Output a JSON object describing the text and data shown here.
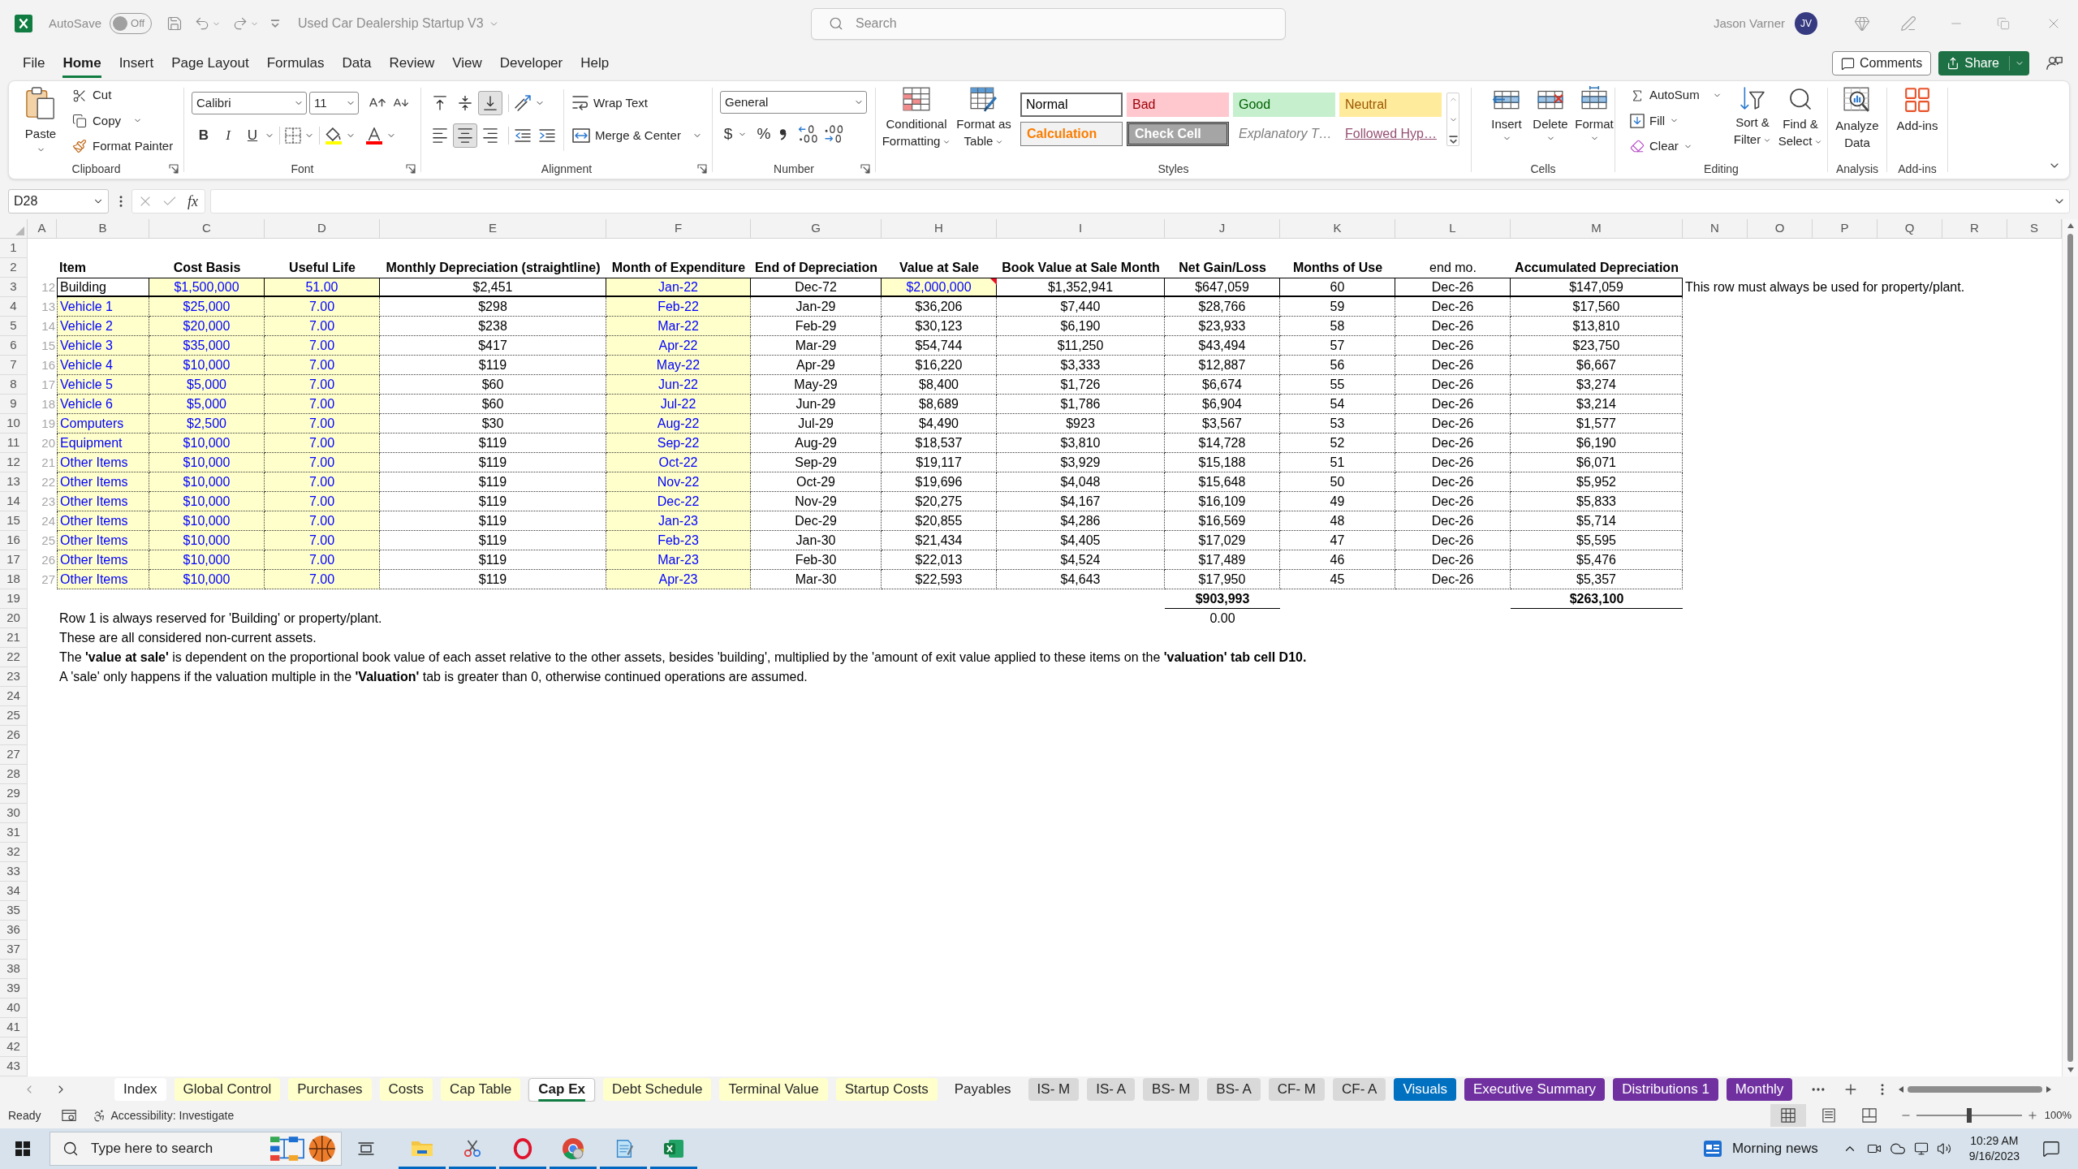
{
  "title_bar": {
    "autosave": {
      "label": "AutoSave",
      "on": false,
      "state_text": "Off"
    },
    "document_title": "Used Car Dealership Startup V3",
    "search": {
      "placeholder": "Search"
    },
    "user": {
      "name": "Jason Varner",
      "initials": "JV"
    }
  },
  "menu": {
    "tabs": [
      {
        "label": "File",
        "selected": false
      },
      {
        "label": "Home",
        "selected": true
      },
      {
        "label": "Insert",
        "selected": false
      },
      {
        "label": "Page Layout",
        "selected": false
      },
      {
        "label": "Formulas",
        "selected": false
      },
      {
        "label": "Data",
        "selected": false
      },
      {
        "label": "Review",
        "selected": false
      },
      {
        "label": "View",
        "selected": false
      },
      {
        "label": "Developer",
        "selected": false
      },
      {
        "label": "Help",
        "selected": false
      }
    ],
    "comments": "Comments",
    "share": "Share"
  },
  "ribbon": {
    "clipboard": {
      "paste": "Paste",
      "cut": "Cut",
      "copy": "Copy",
      "format_painter": "Format Painter",
      "label": "Clipboard"
    },
    "font": {
      "name": "Calibri",
      "size": "11",
      "style_buttons": [
        {
          "label": "B",
          "kind": "bold"
        },
        {
          "label": "I",
          "kind": "italic"
        },
        {
          "label": "U",
          "kind": "underline"
        }
      ],
      "label": "Font"
    },
    "alignment": {
      "vertical": [
        {
          "kind": "top",
          "selected": false
        },
        {
          "kind": "middle",
          "selected": false
        },
        {
          "kind": "bottom",
          "selected": true
        }
      ],
      "horizontal": [
        {
          "kind": "left",
          "selected": false
        },
        {
          "kind": "center",
          "selected": true
        },
        {
          "kind": "right",
          "selected": false
        }
      ],
      "wrap_text": "Wrap Text",
      "merge_center": "Merge & Center",
      "label": "Alignment"
    },
    "number": {
      "format": "General",
      "currency": "$",
      "percent": "%",
      "label": "Number"
    },
    "styles": {
      "conditional_formatting": "Conditional Formatting",
      "format_as_table": "Format as Table",
      "gallery": [
        {
          "label": "Normal",
          "kind": "normal",
          "selected": true
        },
        {
          "label": "Bad",
          "kind": "bad",
          "selected": false
        },
        {
          "label": "Good",
          "kind": "good",
          "selected": false
        },
        {
          "label": "Neutral",
          "kind": "neutral",
          "selected": false
        },
        {
          "label": "Calculation",
          "kind": "calculation",
          "selected": false
        },
        {
          "label": "Check Cell",
          "kind": "check",
          "selected": false
        },
        {
          "label": "Explanatory T…",
          "kind": "explanatory",
          "selected": false
        },
        {
          "label": "Followed Hyp…",
          "kind": "followed_hyperlink",
          "selected": false
        }
      ],
      "label": "Styles"
    },
    "cells": {
      "buttons": [
        {
          "label": "Insert",
          "kind": "insert"
        },
        {
          "label": "Delete",
          "kind": "delete"
        },
        {
          "label": "Format",
          "kind": "format"
        }
      ],
      "label": "Cells"
    },
    "editing": {
      "autosum": "AutoSum",
      "fill": "Fill",
      "clear": "Clear",
      "sort_filter": "Sort & Filter",
      "find_select": "Find & Select",
      "label": "Editing"
    },
    "analysis": {
      "analyze_data": "Analyze Data",
      "label": "Analysis"
    },
    "add_ins": {
      "add_ins": "Add-ins",
      "label": "Add-ins"
    }
  },
  "formula_bar": {
    "name_box": "D28",
    "function_label": "fx"
  },
  "sheet": {
    "column_headers": [
      "A",
      "B",
      "C",
      "D",
      "E",
      "F",
      "G",
      "H",
      "I",
      "J",
      "K",
      "L",
      "M",
      "N",
      "O",
      "P",
      "Q",
      "R",
      "S"
    ],
    "row_headers": [
      "1",
      "2",
      "3",
      "4",
      "5",
      "6",
      "7",
      "8",
      "9",
      "10",
      "11",
      "12",
      "13",
      "14",
      "15",
      "16",
      "17",
      "18",
      "19",
      "20",
      "21",
      "22",
      "23",
      "24",
      "25",
      "26",
      "27",
      "28",
      "29",
      "30",
      "31",
      "32",
      "33",
      "34",
      "35",
      "36",
      "37",
      "38",
      "39",
      "40",
      "41",
      "42",
      "43"
    ],
    "table": {
      "columns": [
        {
          "label": "Item",
          "bold": true
        },
        {
          "label": "Cost Basis",
          "bold": true
        },
        {
          "label": "Useful Life",
          "bold": true
        },
        {
          "label": "Monthly Depreciation (straightline)",
          "bold": true
        },
        {
          "label": "Month of Expenditure",
          "bold": true
        },
        {
          "label": "End of Depreciation",
          "bold": true
        },
        {
          "label": "Value at Sale",
          "bold": true
        },
        {
          "label": "Book Value at Sale Month",
          "bold": true
        },
        {
          "label": "Net Gain/Loss",
          "bold": true
        },
        {
          "label": "Months of Use",
          "bold": true
        },
        {
          "label": "end mo.",
          "bold": false
        },
        {
          "label": "Accumulated Depreciation",
          "bold": true
        }
      ],
      "rows": [
        {
          "index": "12",
          "kind": "property",
          "comment": true,
          "cells": [
            "Building",
            "$1,500,000",
            "51.00",
            "$2,451",
            "Jan-22",
            "Dec-72",
            "$2,000,000",
            "$1,352,941",
            "$647,059",
            "60",
            "Dec-26",
            "$147,059"
          ],
          "note": "This row must always be used for property/plant."
        },
        {
          "index": "13",
          "kind": "asset",
          "comment": false,
          "cells": [
            "Vehicle 1",
            "$25,000",
            "7.00",
            "$298",
            "Feb-22",
            "Jan-29",
            "$36,206",
            "$7,440",
            "$28,766",
            "59",
            "Dec-26",
            "$17,560"
          ]
        },
        {
          "index": "14",
          "kind": "asset",
          "comment": false,
          "cells": [
            "Vehicle 2",
            "$20,000",
            "7.00",
            "$238",
            "Mar-22",
            "Feb-29",
            "$30,123",
            "$6,190",
            "$23,933",
            "58",
            "Dec-26",
            "$13,810"
          ]
        },
        {
          "index": "15",
          "kind": "asset",
          "comment": false,
          "cells": [
            "Vehicle 3",
            "$35,000",
            "7.00",
            "$417",
            "Apr-22",
            "Mar-29",
            "$54,744",
            "$11,250",
            "$43,494",
            "57",
            "Dec-26",
            "$23,750"
          ]
        },
        {
          "index": "16",
          "kind": "asset",
          "comment": false,
          "cells": [
            "Vehicle 4",
            "$10,000",
            "7.00",
            "$119",
            "May-22",
            "Apr-29",
            "$16,220",
            "$3,333",
            "$12,887",
            "56",
            "Dec-26",
            "$6,667"
          ]
        },
        {
          "index": "17",
          "kind": "asset",
          "comment": false,
          "cells": [
            "Vehicle 5",
            "$5,000",
            "7.00",
            "$60",
            "Jun-22",
            "May-29",
            "$8,400",
            "$1,726",
            "$6,674",
            "55",
            "Dec-26",
            "$3,274"
          ]
        },
        {
          "index": "18",
          "kind": "asset",
          "comment": false,
          "cells": [
            "Vehicle 6",
            "$5,000",
            "7.00",
            "$60",
            "Jul-22",
            "Jun-29",
            "$8,689",
            "$1,786",
            "$6,904",
            "54",
            "Dec-26",
            "$3,214"
          ]
        },
        {
          "index": "19",
          "kind": "asset",
          "comment": false,
          "cells": [
            "Computers",
            "$2,500",
            "7.00",
            "$30",
            "Aug-22",
            "Jul-29",
            "$4,490",
            "$923",
            "$3,567",
            "53",
            "Dec-26",
            "$1,577"
          ]
        },
        {
          "index": "20",
          "kind": "asset",
          "comment": false,
          "cells": [
            "Equipment",
            "$10,000",
            "7.00",
            "$119",
            "Sep-22",
            "Aug-29",
            "$18,537",
            "$3,810",
            "$14,728",
            "52",
            "Dec-26",
            "$6,190"
          ]
        },
        {
          "index": "21",
          "kind": "asset",
          "comment": false,
          "cells": [
            "Other Items",
            "$10,000",
            "7.00",
            "$119",
            "Oct-22",
            "Sep-29",
            "$19,117",
            "$3,929",
            "$15,188",
            "51",
            "Dec-26",
            "$6,071"
          ]
        },
        {
          "index": "22",
          "kind": "asset",
          "comment": false,
          "cells": [
            "Other Items",
            "$10,000",
            "7.00",
            "$119",
            "Nov-22",
            "Oct-29",
            "$19,696",
            "$4,048",
            "$15,648",
            "50",
            "Dec-26",
            "$5,952"
          ]
        },
        {
          "index": "23",
          "kind": "asset",
          "comment": false,
          "cells": [
            "Other Items",
            "$10,000",
            "7.00",
            "$119",
            "Dec-22",
            "Nov-29",
            "$20,275",
            "$4,167",
            "$16,109",
            "49",
            "Dec-26",
            "$5,833"
          ]
        },
        {
          "index": "24",
          "kind": "asset",
          "comment": false,
          "cells": [
            "Other Items",
            "$10,000",
            "7.00",
            "$119",
            "Jan-23",
            "Dec-29",
            "$20,855",
            "$4,286",
            "$16,569",
            "48",
            "Dec-26",
            "$5,714"
          ]
        },
        {
          "index": "25",
          "kind": "asset",
          "comment": false,
          "cells": [
            "Other Items",
            "$10,000",
            "7.00",
            "$119",
            "Feb-23",
            "Jan-30",
            "$21,434",
            "$4,405",
            "$17,029",
            "47",
            "Dec-26",
            "$5,595"
          ]
        },
        {
          "index": "26",
          "kind": "asset",
          "comment": false,
          "cells": [
            "Other Items",
            "$10,000",
            "7.00",
            "$119",
            "Mar-23",
            "Feb-30",
            "$22,013",
            "$4,524",
            "$17,489",
            "46",
            "Dec-26",
            "$5,476"
          ]
        },
        {
          "index": "27",
          "kind": "asset",
          "comment": false,
          "cells": [
            "Other Items",
            "$10,000",
            "7.00",
            "$119",
            "Apr-23",
            "Mar-30",
            "$22,593",
            "$4,643",
            "$17,950",
            "45",
            "Dec-26",
            "$5,357"
          ]
        }
      ],
      "totals": {
        "net_gain_loss": "$903,993",
        "accumulated_depreciation": "$263,100"
      },
      "check_value": "0.00"
    },
    "notes": [
      "Row 1 is always reserved for 'Building' or property/plant.",
      "These are all considered non-current assets.",
      "The **'value at sale'** is dependent on the proportional book value of each asset relative to the other assets, besides 'building', multiplied by the 'amount of exit value applied to these items on the **'valuation' tab cell D10.**",
      "A 'sale' only happens if the valuation multiple in the **'Valuation'** tab is greater than 0, otherwise continued operations are assumed."
    ]
  },
  "sheet_tabs": [
    {
      "label": "Index",
      "selected": false,
      "color": "#ffffff"
    },
    {
      "label": "Global Control",
      "selected": false,
      "color": "#ffffcc"
    },
    {
      "label": "Purchases",
      "selected": false,
      "color": "#ffffcc"
    },
    {
      "label": "Costs",
      "selected": false,
      "color": "#ffffcc"
    },
    {
      "label": "Cap Table",
      "selected": false,
      "color": "#ffffcc"
    },
    {
      "label": "Cap Ex",
      "selected": true
    },
    {
      "label": "Debt Schedule",
      "selected": false,
      "color": "#ffffcc"
    },
    {
      "label": "Terminal Value",
      "selected": false,
      "color": "#ffffcc"
    },
    {
      "label": "Startup Costs",
      "selected": false,
      "color": "#ffffcc"
    },
    {
      "label": "Payables",
      "selected": false
    },
    {
      "label": "IS- M",
      "selected": false,
      "color": "#d9d9d9"
    },
    {
      "label": "IS- A",
      "selected": false,
      "color": "#d9d9d9"
    },
    {
      "label": "BS- M",
      "selected": false,
      "color": "#d9d9d9"
    },
    {
      "label": "BS- A",
      "selected": false,
      "color": "#d9d9d9"
    },
    {
      "label": "CF- M",
      "selected": false,
      "color": "#d9d9d9"
    },
    {
      "label": "CF- A",
      "selected": false,
      "color": "#d9d9d9"
    },
    {
      "label": "Visuals",
      "selected": false,
      "color": "#0070c0"
    },
    {
      "label": "Executive Summary",
      "selected": false,
      "color": "#7030a0"
    },
    {
      "label": "Distributions 1",
      "selected": false,
      "color": "#7030a0"
    },
    {
      "label": "Monthly",
      "selected": false,
      "color": "#7030a0"
    }
  ],
  "status_bar": {
    "mode": "Ready",
    "accessibility": "Accessibility: Investigate",
    "views": [
      {
        "kind": "normal",
        "selected": true
      },
      {
        "kind": "page_layout",
        "selected": false
      },
      {
        "kind": "page_break_preview",
        "selected": false
      }
    ],
    "zoom": {
      "level": 0.5,
      "reading": "100%"
    }
  },
  "taskbar": {
    "search_placeholder": "Type here to search",
    "apps": [
      {
        "kind": "file_explorer",
        "running": true
      },
      {
        "kind": "snipping_tool",
        "running": true
      },
      {
        "kind": "opera",
        "running": true
      },
      {
        "kind": "chrome",
        "running": true
      },
      {
        "kind": "notepad",
        "running": true
      },
      {
        "kind": "excel",
        "running": true
      }
    ],
    "news": "Morning news",
    "time": "10:29 AM",
    "date": "9/16/2023"
  }
}
